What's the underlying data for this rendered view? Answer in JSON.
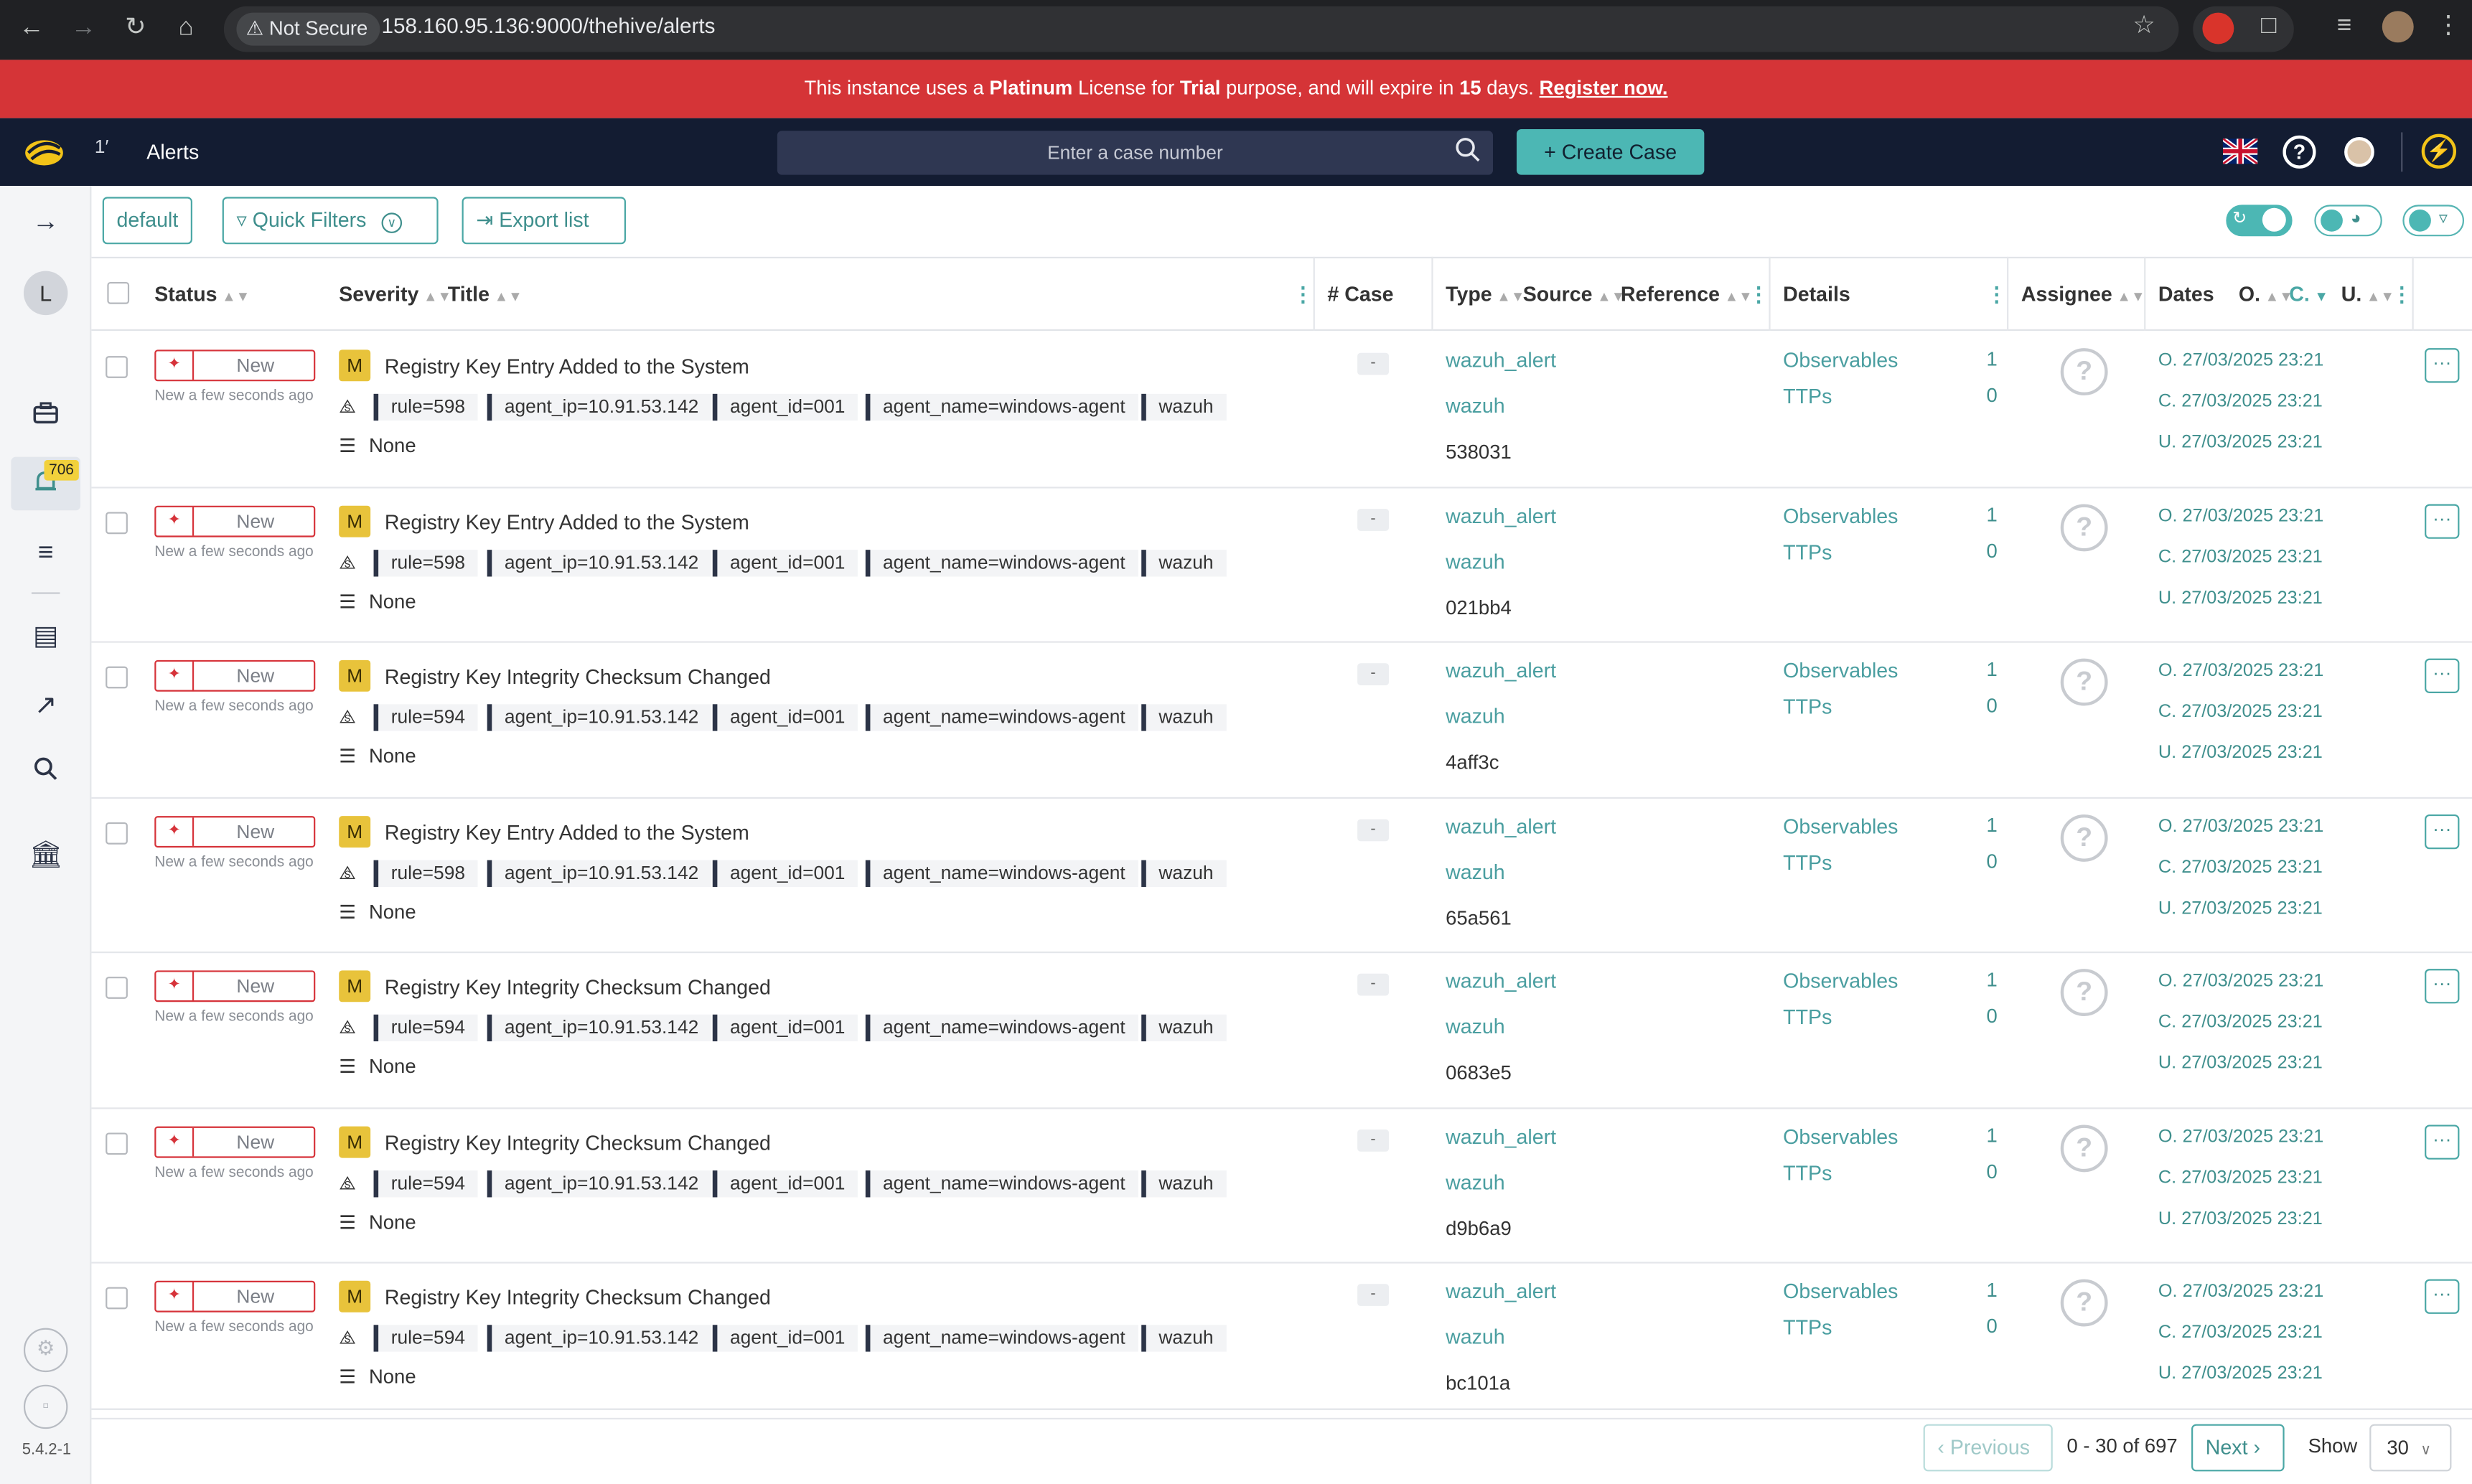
{
  "browser": {
    "security_label": "Not Secure",
    "url": "158.160.95.136:9000/thehive/alerts"
  },
  "banner": {
    "t1": "This instance uses a ",
    "b1": "Platinum",
    "t2": " License for ",
    "b2": "Trial",
    "t3": " purpose, and will expire in ",
    "b3": "15",
    "t4": " days. ",
    "link": "Register now."
  },
  "header": {
    "page_title": "Alerts",
    "search_placeholder": "Enter a case number",
    "create_case": "Create Case"
  },
  "sidebar": {
    "avatar_letter": "L",
    "alerts_badge": "706",
    "version": "5.4.2-1"
  },
  "toolbar": {
    "filter_name": "default",
    "quick_filters": "Quick Filters",
    "export": "Export list"
  },
  "columns": {
    "status": "Status",
    "severity": "Severity",
    "title": "Title",
    "case": "# Case",
    "type": "Type",
    "source": "Source",
    "reference": "Reference",
    "details": "Details",
    "assignee": "Assignee",
    "dates": "Dates",
    "date_o": "O.",
    "date_c": "C.",
    "date_u": "U."
  },
  "labels": {
    "observables": "Observables",
    "ttps": "TTPs",
    "none": "None",
    "case_none": "-"
  },
  "rows": [
    {
      "status": "New",
      "ago": "New a few seconds ago",
      "severity": "M",
      "title": "Registry Key Entry Added to the System",
      "tags": [
        "rule=598",
        "agent_ip=10.91.53.142",
        "agent_id=001",
        "agent_name=windows-agent",
        "wazuh"
      ],
      "type": "wazuh_alert",
      "source": "wazuh",
      "reference": "538031",
      "observables": "1",
      "ttps": "0",
      "date_o": "O. 27/03/2025 23:21",
      "date_c": "C. 27/03/2025 23:21",
      "date_u": "U. 27/03/2025 23:21"
    },
    {
      "status": "New",
      "ago": "New a few seconds ago",
      "severity": "M",
      "title": "Registry Key Entry Added to the System",
      "tags": [
        "rule=598",
        "agent_ip=10.91.53.142",
        "agent_id=001",
        "agent_name=windows-agent",
        "wazuh"
      ],
      "type": "wazuh_alert",
      "source": "wazuh",
      "reference": "021bb4",
      "observables": "1",
      "ttps": "0",
      "date_o": "O. 27/03/2025 23:21",
      "date_c": "C. 27/03/2025 23:21",
      "date_u": "U. 27/03/2025 23:21"
    },
    {
      "status": "New",
      "ago": "New a few seconds ago",
      "severity": "M",
      "title": "Registry Key Integrity Checksum Changed",
      "tags": [
        "rule=594",
        "agent_ip=10.91.53.142",
        "agent_id=001",
        "agent_name=windows-agent",
        "wazuh"
      ],
      "type": "wazuh_alert",
      "source": "wazuh",
      "reference": "4aff3c",
      "observables": "1",
      "ttps": "0",
      "date_o": "O. 27/03/2025 23:21",
      "date_c": "C. 27/03/2025 23:21",
      "date_u": "U. 27/03/2025 23:21"
    },
    {
      "status": "New",
      "ago": "New a few seconds ago",
      "severity": "M",
      "title": "Registry Key Entry Added to the System",
      "tags": [
        "rule=598",
        "agent_ip=10.91.53.142",
        "agent_id=001",
        "agent_name=windows-agent",
        "wazuh"
      ],
      "type": "wazuh_alert",
      "source": "wazuh",
      "reference": "65a561",
      "observables": "1",
      "ttps": "0",
      "date_o": "O. 27/03/2025 23:21",
      "date_c": "C. 27/03/2025 23:21",
      "date_u": "U. 27/03/2025 23:21"
    },
    {
      "status": "New",
      "ago": "New a few seconds ago",
      "severity": "M",
      "title": "Registry Key Integrity Checksum Changed",
      "tags": [
        "rule=594",
        "agent_ip=10.91.53.142",
        "agent_id=001",
        "agent_name=windows-agent",
        "wazuh"
      ],
      "type": "wazuh_alert",
      "source": "wazuh",
      "reference": "0683e5",
      "observables": "1",
      "ttps": "0",
      "date_o": "O. 27/03/2025 23:21",
      "date_c": "C. 27/03/2025 23:21",
      "date_u": "U. 27/03/2025 23:21"
    },
    {
      "status": "New",
      "ago": "New a few seconds ago",
      "severity": "M",
      "title": "Registry Key Integrity Checksum Changed",
      "tags": [
        "rule=594",
        "agent_ip=10.91.53.142",
        "agent_id=001",
        "agent_name=windows-agent",
        "wazuh"
      ],
      "type": "wazuh_alert",
      "source": "wazuh",
      "reference": "d9b6a9",
      "observables": "1",
      "ttps": "0",
      "date_o": "O. 27/03/2025 23:21",
      "date_c": "C. 27/03/2025 23:21",
      "date_u": "U. 27/03/2025 23:21"
    },
    {
      "status": "New",
      "ago": "New a few seconds ago",
      "severity": "M",
      "title": "Registry Key Integrity Checksum Changed",
      "tags": [
        "rule=594",
        "agent_ip=10.91.53.142",
        "agent_id=001",
        "agent_name=windows-agent",
        "wazuh"
      ],
      "type": "wazuh_alert",
      "source": "wazuh",
      "reference": "bc101a",
      "observables": "1",
      "ttps": "0",
      "date_o": "O. 27/03/2025 23:21",
      "date_c": "C. 27/03/2025 23:21",
      "date_u": "U. 27/03/2025 23:21"
    }
  ],
  "pagination": {
    "previous": "Previous",
    "range": "0 - 30 of 697",
    "next": "Next",
    "show_label": "Show",
    "page_size": "30"
  }
}
